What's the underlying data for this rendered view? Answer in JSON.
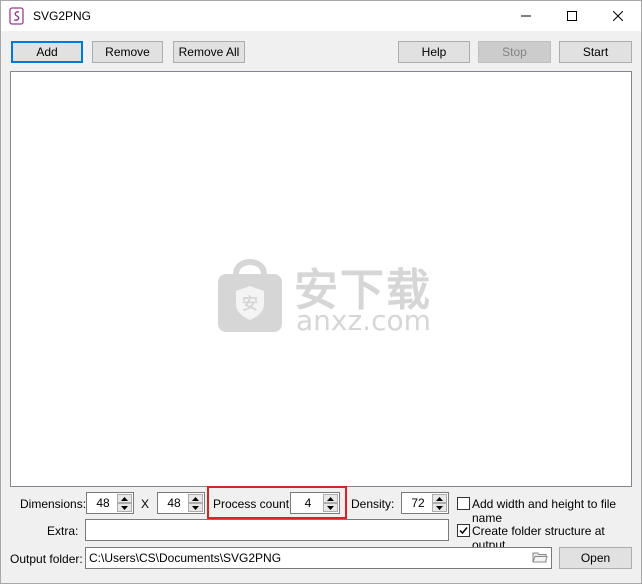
{
  "window": {
    "title": "SVG2PNG"
  },
  "toolbar": {
    "add_label": "Add",
    "remove_label": "Remove",
    "remove_all_label": "Remove All",
    "help_label": "Help",
    "stop_label": "Stop",
    "start_label": "Start"
  },
  "watermark": {
    "cn": "安下载",
    "en": "anxz.com",
    "shield": "安"
  },
  "options": {
    "dimensions_label": "Dimensions:",
    "width_value": "48",
    "x_label": "X",
    "height_value": "48",
    "process_count_label": "Process count:",
    "process_count_value": "4",
    "density_label": "Density:",
    "density_value": "72",
    "add_wh_label": "Add width and height to file name",
    "add_wh_checked": false,
    "extra_label": "Extra:",
    "extra_value": "",
    "create_folder_label": "Create folder structure at output",
    "create_folder_checked": true,
    "output_folder_label": "Output folder:",
    "output_folder_value": "C:\\Users\\CS\\Documents\\SVG2PNG",
    "open_label": "Open"
  },
  "colors": {
    "accent": "#0078d7",
    "highlight": "#e02020"
  }
}
